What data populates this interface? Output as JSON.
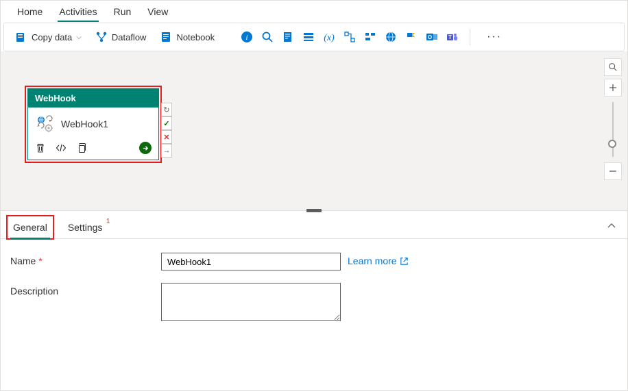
{
  "menu": {
    "items": [
      {
        "label": "Home",
        "active": false
      },
      {
        "label": "Activities",
        "active": true
      },
      {
        "label": "Run",
        "active": false
      },
      {
        "label": "View",
        "active": false
      }
    ]
  },
  "toolbar": {
    "copy_data_label": "Copy data",
    "dataflow_label": "Dataflow",
    "notebook_label": "Notebook"
  },
  "activity": {
    "type_label": "WebHook",
    "instance_name": "WebHook1"
  },
  "props": {
    "tabs": {
      "general": "General",
      "settings": "Settings",
      "settings_badge": "1"
    },
    "name_label": "Name",
    "name_value": "WebHook1",
    "desc_label": "Description",
    "desc_value": "",
    "learn_more": "Learn more"
  }
}
